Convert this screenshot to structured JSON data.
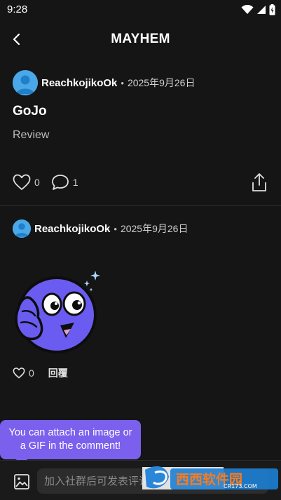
{
  "status_bar": {
    "time": "9:28",
    "icons": [
      "wifi-icon",
      "signal-icon",
      "battery-icon"
    ]
  },
  "header": {
    "title": "MAYHEM",
    "back_icon": "chevron-left-icon"
  },
  "post": {
    "author": "ReachkojikoOk",
    "separator": "•",
    "date": "2025年9月26日",
    "title": "GoJo",
    "body": "Review",
    "like_count": "0",
    "comment_count": "1"
  },
  "comment": {
    "author": "ReachkojikoOk",
    "separator": "•",
    "date": "2025年9月26日",
    "sticker": "purple-smiley-sticker",
    "like_count": "0",
    "reply_label": "回覆"
  },
  "tooltip": {
    "text": "You can attach an image or a GIF in the comment!"
  },
  "input_bar": {
    "placeholder": "加入社群后可发表评论"
  },
  "watermark": {
    "text": "西西软件园",
    "sub": "CR173.COM"
  },
  "colors": {
    "background": "#151515",
    "accent": "#7b60ee",
    "avatar": "#4aa8e8",
    "sticker": "#6a5cf0"
  }
}
